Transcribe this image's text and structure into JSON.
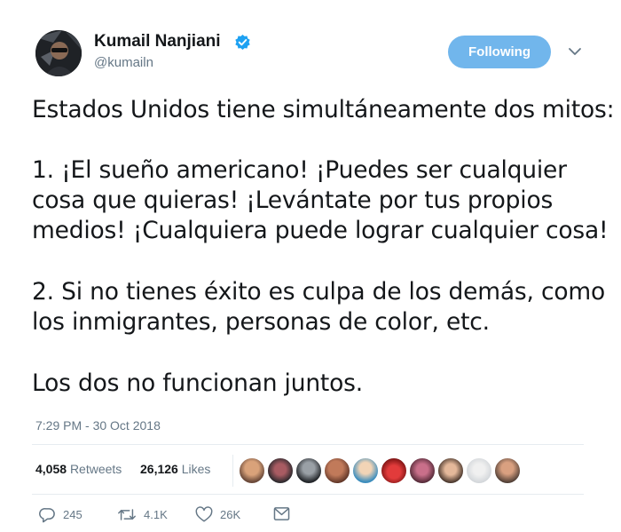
{
  "author": {
    "display_name": "Kumail Nanjiani",
    "handle": "@kumailn",
    "verified": true
  },
  "follow_button": {
    "label": "Following"
  },
  "tweet": {
    "lines": [
      "Estados Unidos tiene simultáneamente dos mitos:",
      "1. ¡El sueño americano! ¡Puedes ser cualquier",
      "cosa que quieras! ¡Levántate por tus propios",
      "medios! ¡Cualquiera puede lograr cualquier cosa!",
      "2. Si no tienes éxito es culpa de los demás, como",
      "los inmigrantes, personas de color, etc.",
      "Los dos no funcionan juntos."
    ],
    "timestamp": "7:29 PM - 30 Oct 2018"
  },
  "stats": {
    "retweets_count": "4,058",
    "retweets_label": "Retweets",
    "likes_count": "26,126",
    "likes_label": "Likes"
  },
  "actions": {
    "reply_count": "245",
    "retweet_count": "4.1K",
    "like_count": "26K"
  },
  "colors": {
    "accent": "#71b6ec",
    "muted_text": "#657786",
    "main_text": "#14171a"
  }
}
